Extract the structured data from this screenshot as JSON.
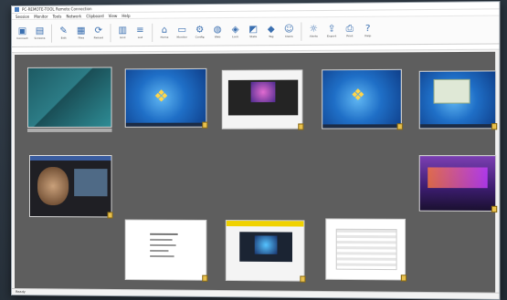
{
  "window": {
    "title": "PC-REMOTE-TOOL Remote Connection"
  },
  "menu": [
    "Session",
    "Monitor",
    "Tools",
    "Network",
    "Clipboard",
    "View",
    "Help"
  ],
  "toolbar": {
    "buttons": [
      {
        "icon": "connect-icon",
        "glyph": "▣",
        "label": "Connect"
      },
      {
        "icon": "screens-icon",
        "glyph": "▤",
        "label": "Screens"
      },
      {
        "icon": "pen-icon",
        "glyph": "✎",
        "label": "Edit"
      },
      {
        "icon": "file-icon",
        "glyph": "▦",
        "label": "Files"
      },
      {
        "icon": "refresh-icon",
        "glyph": "⟳",
        "label": "Reload"
      },
      {
        "icon": "grid-icon",
        "glyph": "▥",
        "label": "Grid"
      },
      {
        "icon": "list-icon",
        "glyph": "≡",
        "label": "List"
      },
      {
        "icon": "home-icon",
        "glyph": "⌂",
        "label": "Home"
      },
      {
        "icon": "monitor-icon",
        "glyph": "▭",
        "label": "Monitor"
      },
      {
        "icon": "settings-icon",
        "glyph": "⚙",
        "label": "Config"
      },
      {
        "icon": "globe-icon",
        "glyph": "◍",
        "label": "Web"
      },
      {
        "icon": "lock-icon",
        "glyph": "◈",
        "label": "Lock"
      },
      {
        "icon": "chart-icon",
        "glyph": "◩",
        "label": "Stats"
      },
      {
        "icon": "tag-icon",
        "glyph": "◆",
        "label": "Tag"
      },
      {
        "icon": "users-icon",
        "glyph": "☺",
        "label": "Users"
      },
      {
        "icon": "bell-icon",
        "glyph": "☼",
        "label": "Alerts"
      },
      {
        "icon": "export-icon",
        "glyph": "⇪",
        "label": "Export"
      },
      {
        "icon": "print-icon",
        "glyph": "⎙",
        "label": "Print"
      },
      {
        "icon": "help-icon",
        "glyph": "?",
        "label": "Help"
      }
    ]
  },
  "thumbnails": [
    {
      "style": "teal",
      "caption": ""
    },
    {
      "style": "w7",
      "caption": ""
    },
    {
      "style": "web",
      "caption": ""
    },
    {
      "style": "w7",
      "caption": ""
    },
    {
      "style": "w7",
      "caption": ""
    },
    {
      "style": "dark",
      "caption": ""
    },
    {
      "style": "purple",
      "caption": ""
    },
    {
      "style": "doc",
      "caption": ""
    },
    {
      "style": "dark",
      "caption": ""
    },
    {
      "style": "doc",
      "caption": ""
    }
  ],
  "status": {
    "text": "Ready"
  },
  "colors": {
    "canvas": "#5e5e5e",
    "accent": "#3a6fb0",
    "pin": "#e8c04c"
  }
}
